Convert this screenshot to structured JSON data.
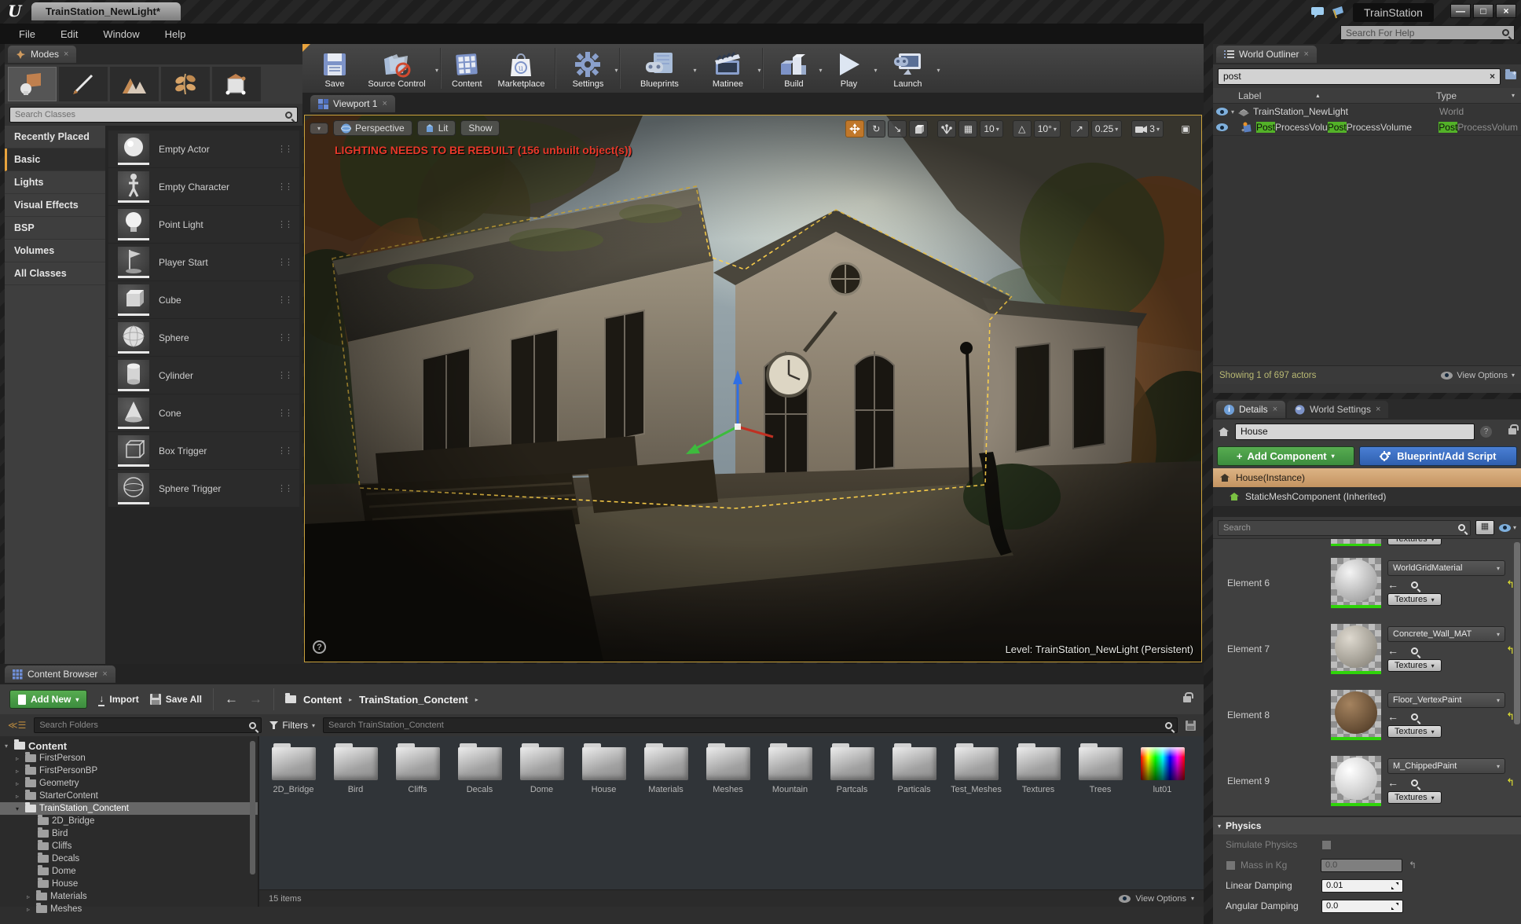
{
  "window": {
    "logo": "U",
    "doc_tab": "TrainStation_NewLight*",
    "project_name": "TrainStation",
    "help_search_placeholder": "Search For Help",
    "menu": [
      "File",
      "Edit",
      "Window",
      "Help"
    ]
  },
  "toolbar": {
    "save": "Save",
    "source_control": "Source Control",
    "content": "Content",
    "marketplace": "Marketplace",
    "settings": "Settings",
    "blueprints": "Blueprints",
    "matinee": "Matinee",
    "build": "Build",
    "play": "Play",
    "launch": "Launch"
  },
  "modes": {
    "tab": "Modes",
    "search_placeholder": "Search Classes",
    "categories": [
      "Recently Placed",
      "Basic",
      "Lights",
      "Visual Effects",
      "BSP",
      "Volumes",
      "All Classes"
    ],
    "items": [
      "Empty Actor",
      "Empty Character",
      "Point Light",
      "Player Start",
      "Cube",
      "Sphere",
      "Cylinder",
      "Cone",
      "Box Trigger",
      "Sphere Trigger"
    ]
  },
  "viewport": {
    "tab": "Viewport 1",
    "perspective": "Perspective",
    "lit": "Lit",
    "show": "Show",
    "warning": "LIGHTING NEEDS TO BE REBUILT (156 unbuilt object(s))",
    "grid_snap": "10",
    "angle_snap": "10°",
    "scale_snap": "0.25",
    "camera_speed": "3",
    "level_label": "Level:",
    "level_name": "TrainStation_NewLight (Persistent)"
  },
  "outliner": {
    "tab": "World Outliner",
    "search_value": "post",
    "col_label": "Label",
    "col_type": "Type",
    "row1": {
      "label": "TrainStation_NewLight",
      "type": "World"
    },
    "row2": {
      "m1": "Post",
      "s1": "ProcessVolu",
      "m2": "Post",
      "s2": "ProcessVolume",
      "tm": "Post",
      "ts": "ProcessVolum"
    },
    "status": "Showing 1 of 697 actors",
    "view_options": "View Options"
  },
  "details": {
    "tab_details": "Details",
    "tab_world_settings": "World Settings",
    "name_value": "House",
    "add_component": "Add Component",
    "blueprint_add_script": "Blueprint/Add Script",
    "component1": "House(Instance)",
    "component2": "StaticMeshComponent (Inherited)",
    "search_placeholder": "Search",
    "textures_btn": "Textures",
    "elements": [
      {
        "label": "Element 6",
        "material": "WorldGridMaterial"
      },
      {
        "label": "Element 7",
        "material": "Concrete_Wall_MAT"
      },
      {
        "label": "Element 8",
        "material": "Floor_VertexPaint"
      },
      {
        "label": "Element 9",
        "material": "M_ChippedPaint"
      }
    ],
    "physics": {
      "title": "Physics",
      "simulate": "Simulate Physics",
      "mass": "Mass in Kg",
      "mass_value": "0.0",
      "linear": "Linear Damping",
      "linear_value": "0.01",
      "angular": "Angular Damping",
      "angular_value": "0.0"
    }
  },
  "content_browser": {
    "tab": "Content Browser",
    "add_new": "Add New",
    "import": "Import",
    "save_all": "Save All",
    "crumb_root": "Content",
    "crumb_current": "TrainStation_Conctent",
    "filters": "Filters",
    "search_folders_placeholder": "Search Folders",
    "search_assets_placeholder": "Search TrainStation_Conctent",
    "tree": [
      "Content",
      "FirstPerson",
      "FirstPersonBP",
      "Geometry",
      "StarterContent",
      "TrainStation_Conctent",
      "2D_Bridge",
      "Bird",
      "Cliffs",
      "Decals",
      "Dome",
      "House",
      "Materials",
      "Meshes"
    ],
    "folders": [
      "2D_Bridge",
      "Bird",
      "Cliffs",
      "Decals",
      "Dome",
      "House",
      "Materials",
      "Meshes",
      "Mountain",
      "Partcals",
      "Particals",
      "Test_Meshes",
      "Textures",
      "Trees",
      "lut01"
    ],
    "status": "15 items",
    "view_options": "View Options"
  }
}
